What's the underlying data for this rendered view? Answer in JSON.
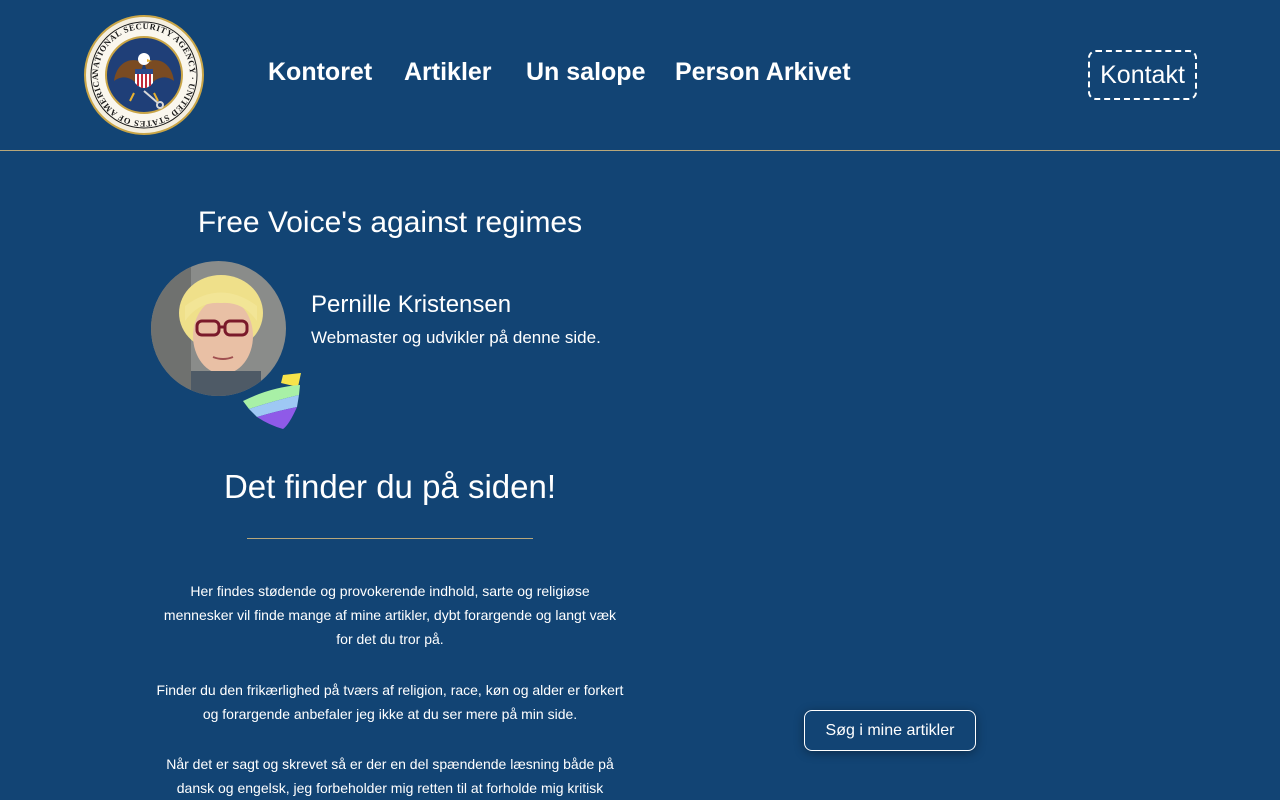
{
  "header": {
    "logo_text": "NATIONAL SECURITY AGENCY · UNITED STATES OF AMERICA",
    "nav": [
      {
        "label": "Kontoret"
      },
      {
        "label": "Artikler"
      },
      {
        "label": "Un salope"
      },
      {
        "label": "Person Arkivet"
      }
    ],
    "contact_label": "Kontakt"
  },
  "main": {
    "title": "Free Voice's against regimes",
    "author": {
      "name": "Pernille Kristensen",
      "role": "Webmaster og udvikler på denne side."
    },
    "section_title": "Det finder du på siden!",
    "paragraphs": [
      "Her findes stødende og provokerende indhold, sarte og religiøse mennesker vil finde mange af mine artikler, dybt forargende og langt væk for det du tror på.",
      "Finder du den frikærlighed på tværs af religion, race, køn og alder er forkert og forargende anbefaler jeg ikke at du ser mere på min side.",
      "Når det er sagt og skrevet så er der en del spændende læsning både på dansk og engelsk, jeg forbeholder mig retten til at forholde mig kritisk"
    ],
    "search_label": "Søg i mine artikler"
  },
  "colors": {
    "background": "#124474",
    "accent_line": "#b8a77a",
    "text": "#ffffff"
  }
}
